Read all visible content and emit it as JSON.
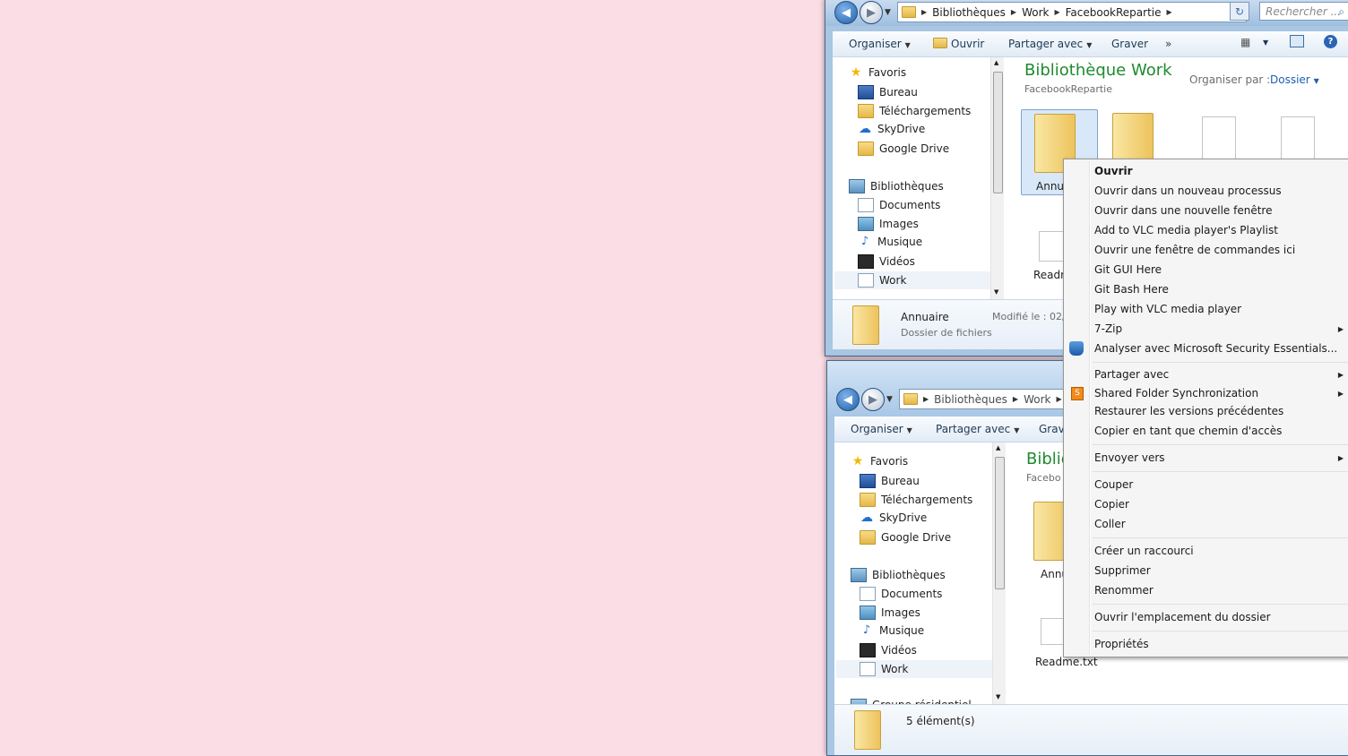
{
  "colors": {
    "desktop_bg": "#fbdde6",
    "library_title": "#1e8a2e",
    "menu_bg": "#f5f5f5"
  },
  "win1": {
    "breadcrumb": [
      "Bibliothèques",
      "Work",
      "FacebookRepartie"
    ],
    "search_placeholder": "Rechercher ...",
    "toolbar": {
      "organiser": "Organiser",
      "ouvrir": "Ouvrir",
      "partager": "Partager avec",
      "graver": "Graver",
      "more": "»"
    },
    "nav": {
      "favoris": "Favoris",
      "bureau": "Bureau",
      "telechargements": "Téléchargements",
      "skydrive": "SkyDrive",
      "googledrive": "Google Drive",
      "bibliotheques": "Bibliothèques",
      "documents": "Documents",
      "images": "Images",
      "musique": "Musique",
      "videos": "Vidéos",
      "work": "Work"
    },
    "library_title": "Bibliothèque Work",
    "library_subtitle": "FacebookRepartie",
    "arrange_label": "Organiser par :",
    "arrange_value": "Dossier",
    "files": {
      "annuaire_label": "Annu",
      "readme_label": "Readm"
    },
    "details": {
      "name": "Annuaire",
      "type": "Dossier de fichiers",
      "modified_label": "Modifié le : 02/"
    }
  },
  "win2": {
    "breadcrumb": [
      "Bibliothèques",
      "Work"
    ],
    "toolbar": {
      "organiser": "Organiser",
      "partager": "Partager avec",
      "graver": "Grave"
    },
    "nav": {
      "favoris": "Favoris",
      "bureau": "Bureau",
      "telechargements": "Téléchargements",
      "skydrive": "SkyDrive",
      "googledrive": "Google Drive",
      "bibliotheques": "Bibliothèques",
      "documents": "Documents",
      "images": "Images",
      "musique": "Musique",
      "videos": "Vidéos",
      "work": "Work",
      "groupe": "Groupe résidentiel"
    },
    "library_title": "Biblio",
    "library_subtitle": "Facebo",
    "files": {
      "annuaire_label": "Annu",
      "readme_label": "Readme.txt"
    },
    "status": "5 élément(s)"
  },
  "context_menu": {
    "ouvrir": "Ouvrir",
    "nouveau_processus": "Ouvrir dans un nouveau processus",
    "nouvelle_fenetre": "Ouvrir dans une nouvelle fenêtre",
    "vlc_playlist": "Add to VLC media player's Playlist",
    "commandes": "Ouvrir une fenêtre de commandes ici",
    "git_gui": "Git GUI Here",
    "git_bash": "Git Bash Here",
    "vlc_play": "Play with VLC media player",
    "zip": "7-Zip",
    "mse": "Analyser avec Microsoft Security Essentials...",
    "partager": "Partager avec",
    "shared_sync": "Shared Folder Synchronization",
    "restaurer": "Restaurer les versions précédentes",
    "copier_chemin": "Copier en tant que chemin d'accès",
    "envoyer": "Envoyer vers",
    "couper": "Couper",
    "copier": "Copier",
    "coller": "Coller",
    "raccourci": "Créer un raccourci",
    "supprimer": "Supprimer",
    "renommer": "Renommer",
    "emplacement": "Ouvrir l'emplacement du dossier",
    "proprietes": "Propriétés"
  }
}
